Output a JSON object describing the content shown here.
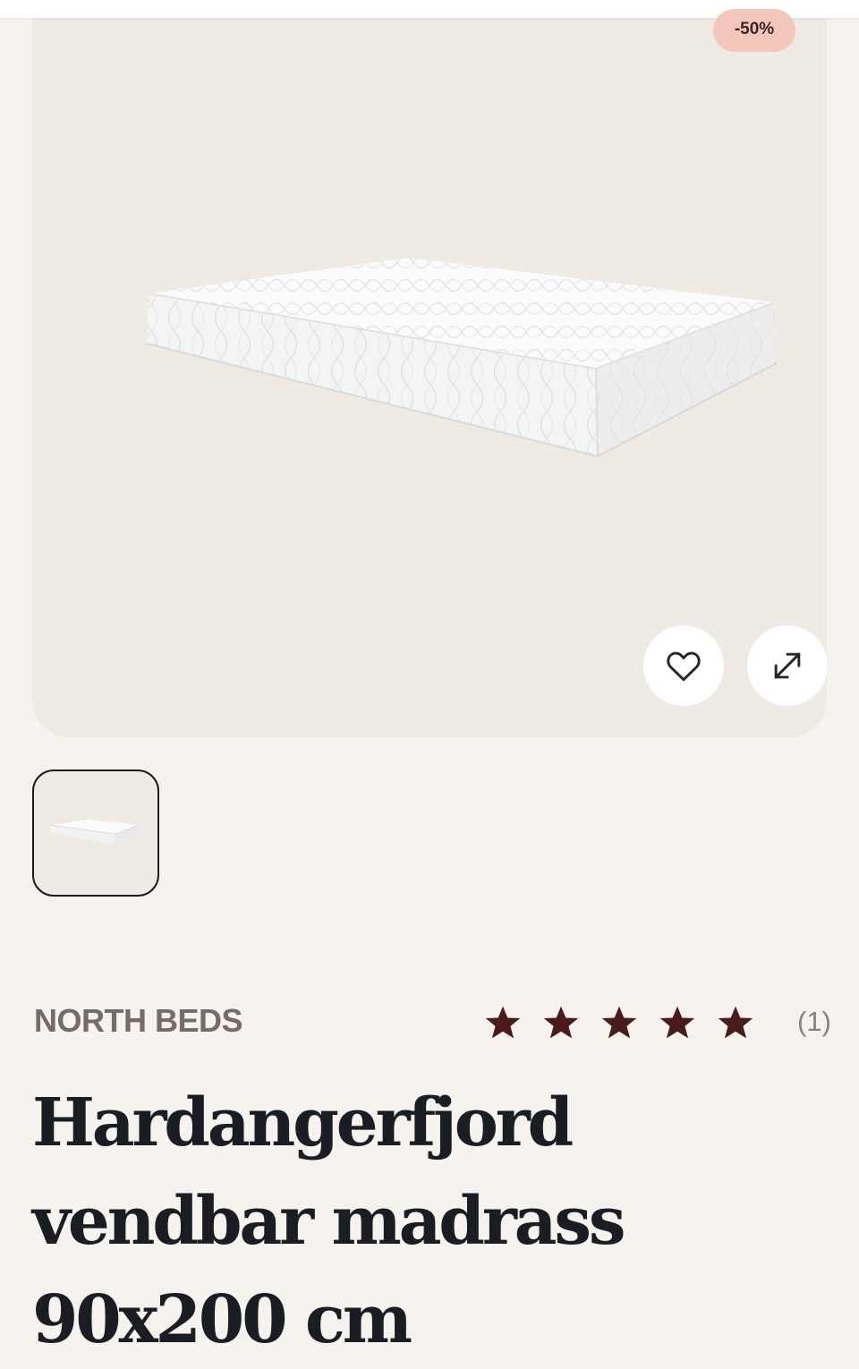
{
  "colors": {
    "page_background": "#f6f2ee",
    "image_background": "#efebe4",
    "badge_background": "#f4c7bd",
    "star_color": "#4b1a1a",
    "brand_color": "#756b67",
    "title_color": "#1b1d24"
  },
  "product": {
    "discount_badge": "-50%",
    "brand": "NORTH BEDS",
    "rating": {
      "stars": 5,
      "max_stars": 5,
      "count_label": "(1)"
    },
    "title": "Hardangerfjord vendbar madrass 90x200 cm"
  },
  "gallery": {
    "icons": {
      "favorite": "heart-icon",
      "expand": "expand-arrows-icon"
    },
    "thumbnails": [
      {
        "selected": true
      }
    ]
  }
}
